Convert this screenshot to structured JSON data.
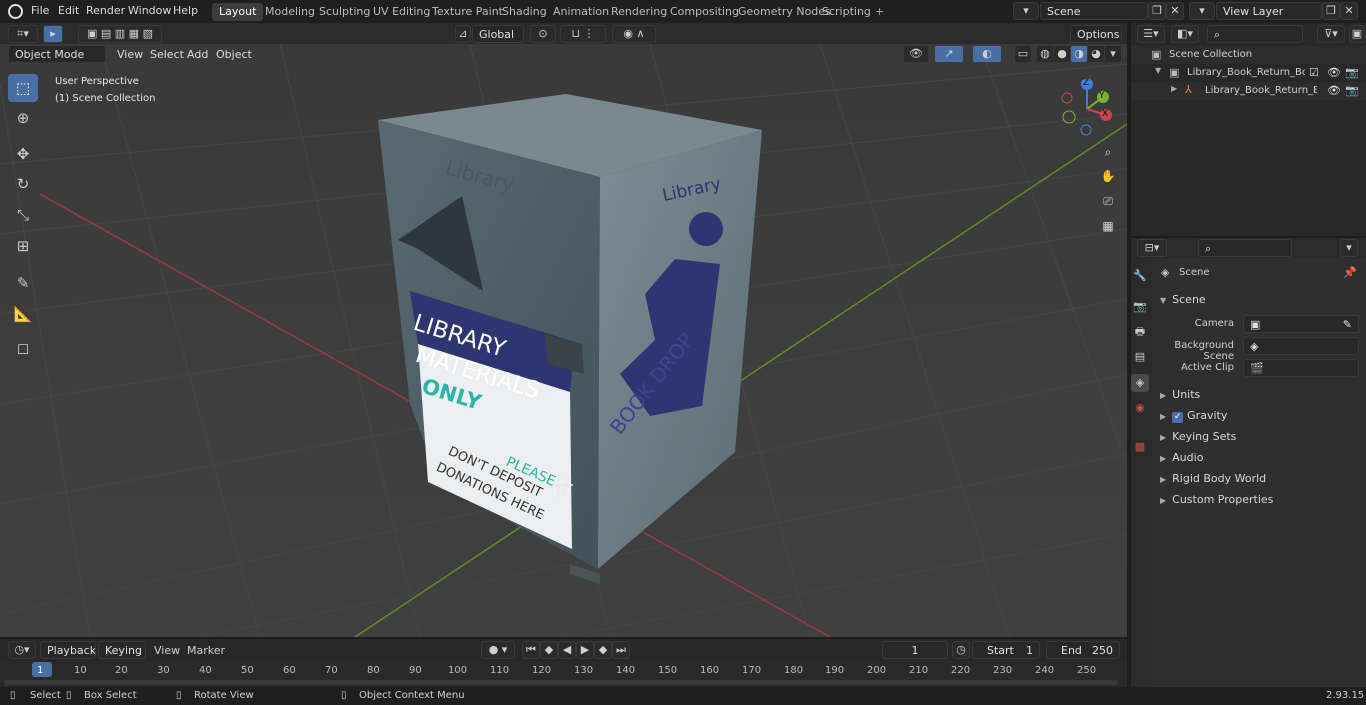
{
  "top_menu": {
    "file": "File",
    "edit": "Edit",
    "render": "Render",
    "window": "Window",
    "help": "Help"
  },
  "workspace_tabs": [
    "Layout",
    "Modeling",
    "Sculpting",
    "UV Editing",
    "Texture Paint",
    "Shading",
    "Animation",
    "Rendering",
    "Compositing",
    "Geometry Nodes",
    "Scripting"
  ],
  "scene_field": "Scene",
  "view_layer_field": "View Layer",
  "viewport_header": {
    "transform_orientation": "Global",
    "options": "Options"
  },
  "mode_bar": {
    "mode": "Object Mode",
    "view": "View",
    "select": "Select",
    "add": "Add",
    "object": "Object"
  },
  "viewport_overlay": {
    "perspective": "User Perspective",
    "collection": "(1) Scene Collection"
  },
  "gizmo_axes": {
    "x": "X",
    "y": "Y",
    "z": "Z"
  },
  "model_text": {
    "lib_front": "Library",
    "sign_line1": "LIBRARY",
    "sign_line2": "MATERIALS",
    "sign_line3": "ONLY",
    "warn_please": "PLEASE",
    "warn_line1": "DON'T DEPOSIT",
    "warn_line2": "DONATIONS HERE",
    "side_library": "Library",
    "side_bookdrop": "BOOK DROP"
  },
  "outliner": {
    "scene_collection": "Scene Collection",
    "item1": "Library_Book_Return_Box_M",
    "item2": "Library_Book_Return_Bo"
  },
  "properties": {
    "title": "Scene",
    "section": "Scene",
    "camera_label": "Camera",
    "bg_scene_label": "Background Scene",
    "active_clip_label": "Active Clip",
    "panels": [
      "Units",
      "Gravity",
      "Keying Sets",
      "Audio",
      "Rigid Body World",
      "Custom Properties"
    ]
  },
  "timeline": {
    "playback": "Playback",
    "keying": "Keying",
    "view": "View",
    "marker": "Marker",
    "current_frame": "1",
    "start_label": "Start",
    "start": "1",
    "end_label": "End",
    "end": "250",
    "ruler": [
      "1",
      "10",
      "20",
      "30",
      "40",
      "50",
      "60",
      "70",
      "80",
      "90",
      "100",
      "110",
      "120",
      "130",
      "140",
      "150",
      "160",
      "170",
      "180",
      "190",
      "200",
      "210",
      "220",
      "230",
      "240",
      "250"
    ]
  },
  "status_bar": {
    "select": "Select",
    "box_select": "Box Select",
    "rotate_view": "Rotate View",
    "context_menu": "Object Context Menu",
    "version": "2.93.15"
  },
  "colors": {
    "accent": "#4a6fa5",
    "x_axis": "#c8444e",
    "y_axis": "#7ab234",
    "z_axis": "#3f7fd8",
    "sign_blue": "#2f3570",
    "box_metal": "#6e7d86"
  }
}
